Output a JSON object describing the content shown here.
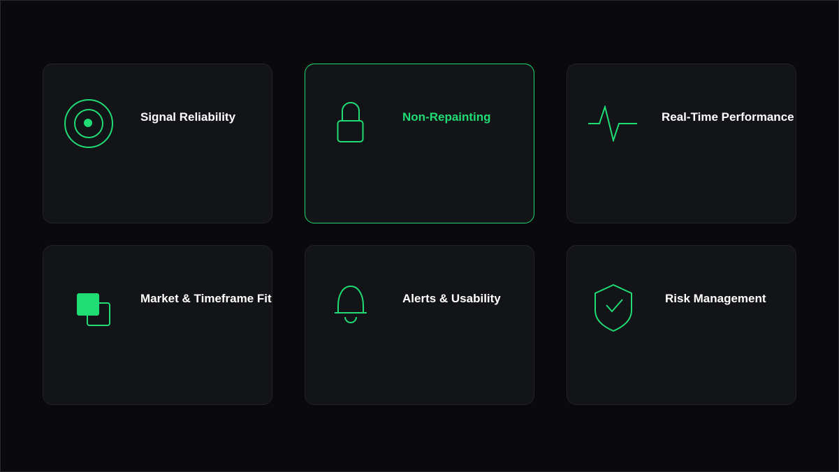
{
  "theme": {
    "accent": "#1fdc74",
    "background": "#0a0a0d",
    "card_background": "#131417",
    "text": "#ffffff"
  },
  "cards": [
    {
      "title": "Signal Reliability",
      "icon": "target-icon",
      "selected": false
    },
    {
      "title": "Non-Repainting",
      "icon": "lock-icon",
      "selected": true
    },
    {
      "title": "Real-Time Performance",
      "icon": "pulse-icon",
      "selected": false
    },
    {
      "title": "Market & Timeframe Fit",
      "icon": "layers-icon",
      "selected": false
    },
    {
      "title": "Alerts & Usability",
      "icon": "bell-icon",
      "selected": false
    },
    {
      "title": "Risk Management",
      "icon": "shield-check-icon",
      "selected": false
    }
  ]
}
